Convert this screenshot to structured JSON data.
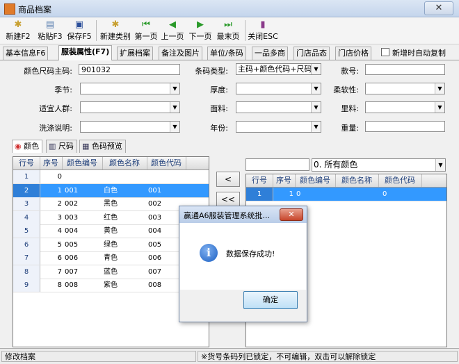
{
  "window": {
    "title": "商品档案",
    "close": "✕"
  },
  "toolbar": [
    {
      "label": "新建F2",
      "icon": "new-doc-icon"
    },
    {
      "label": "粘贴F3",
      "icon": "paste-icon"
    },
    {
      "label": "保存F5",
      "icon": "save-icon"
    },
    {
      "label": "新建类别",
      "icon": "new-category-icon"
    },
    {
      "label": "第一页",
      "icon": "first-page-icon"
    },
    {
      "label": "上一页",
      "icon": "prev-page-icon"
    },
    {
      "label": "下一页",
      "icon": "next-page-icon"
    },
    {
      "label": "最末页",
      "icon": "last-page-icon"
    },
    {
      "label": "关闭ESC",
      "icon": "close-door-icon"
    }
  ],
  "tabs": [
    "基本信息F6",
    "服装属性(F7)",
    "扩展档案",
    "备注及图片",
    "单位/条码",
    "一品多商",
    "门店品态",
    "门店价格"
  ],
  "auto_copy_label": "新增时自动复制",
  "form": {
    "color_size_code_label": "颜色尺码主码:",
    "color_size_code_value": "901032",
    "barcode_type_label": "条码类型:",
    "barcode_type_value": "主码+颜色代码+尺码",
    "model_label": "款号:",
    "season_label": "季节:",
    "thickness_label": "厚度:",
    "softness_label": "柔软性:",
    "audience_label": "适宜人群:",
    "fabric_label": "面料:",
    "lining_label": "里料:",
    "wash_label": "洗涤说明:",
    "year_label": "年份:",
    "weight_label": "重量:"
  },
  "subtabs": [
    {
      "label": "颜色",
      "icon": "color-wheel-icon"
    },
    {
      "label": "尺码",
      "icon": "ruler-chart-icon"
    },
    {
      "label": "色码预览",
      "icon": "grid-table-icon"
    }
  ],
  "left_grid": {
    "headers": [
      "行号",
      "序号",
      "颜色编号",
      "颜色名称",
      "颜色代码"
    ],
    "rows": [
      {
        "row": "1",
        "seq": "0",
        "code": "",
        "name": "",
        "ccode": ""
      },
      {
        "row": "2",
        "seq": "1",
        "code": "001",
        "name": "白色",
        "ccode": "001"
      },
      {
        "row": "3",
        "seq": "2",
        "code": "002",
        "name": "黑色",
        "ccode": "002"
      },
      {
        "row": "4",
        "seq": "3",
        "code": "003",
        "name": "红色",
        "ccode": "003"
      },
      {
        "row": "5",
        "seq": "4",
        "code": "004",
        "name": "黄色",
        "ccode": "004"
      },
      {
        "row": "6",
        "seq": "5",
        "code": "005",
        "name": "绿色",
        "ccode": "005"
      },
      {
        "row": "7",
        "seq": "6",
        "code": "006",
        "name": "青色",
        "ccode": "006"
      },
      {
        "row": "8",
        "seq": "7",
        "code": "007",
        "name": "蓝色",
        "ccode": "007"
      },
      {
        "row": "9",
        "seq": "8",
        "code": "008",
        "name": "紫色",
        "ccode": "008"
      }
    ]
  },
  "mid_buttons": [
    "<",
    "<<"
  ],
  "color_filter": "0. 所有颜色",
  "right_grid": {
    "headers": [
      "行号",
      "序号",
      "颜色编号",
      "颜色名称",
      "颜色代码"
    ],
    "rows": [
      {
        "row": "1",
        "seq": "1",
        "code": "0",
        "name": "",
        "ccode": "0"
      }
    ]
  },
  "dialog": {
    "title": "赢通A6服装管理系统批...",
    "close": "✕",
    "message": "数据保存成功!",
    "ok": "确定"
  },
  "status": {
    "left": "修改档案",
    "right": "※货号条码列已锁定，不可编辑，双击可以解除锁定"
  },
  "colors": {
    "selection": "#3399ff",
    "header_text": "#1f3f7a"
  }
}
